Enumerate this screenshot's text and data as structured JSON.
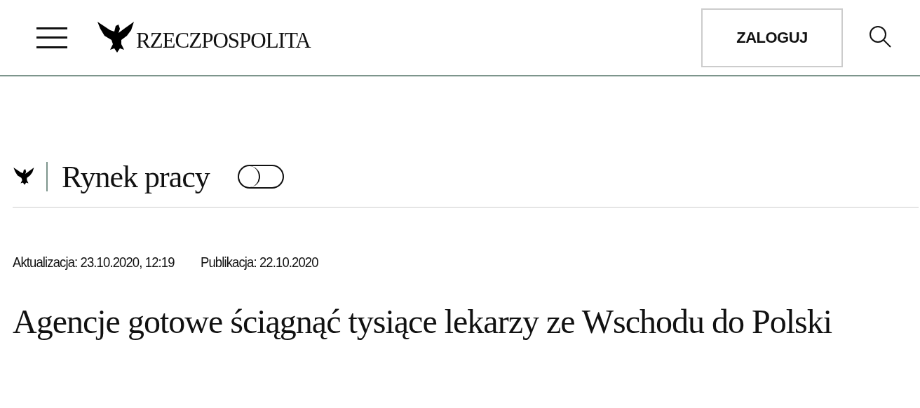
{
  "header": {
    "logo_text": "RZECZPOSPOLITA",
    "login_button": "ZALOGUJ"
  },
  "section": {
    "title": "Rynek pracy",
    "toggle": {
      "on": false
    }
  },
  "article": {
    "updated": "Aktualizacja: 23.10.2020, 12:19",
    "published": "Publikacja: 22.10.2020",
    "headline": "Agencje gotowe ściągnąć tysiące lekarzy ze Wschodu do Polski"
  }
}
